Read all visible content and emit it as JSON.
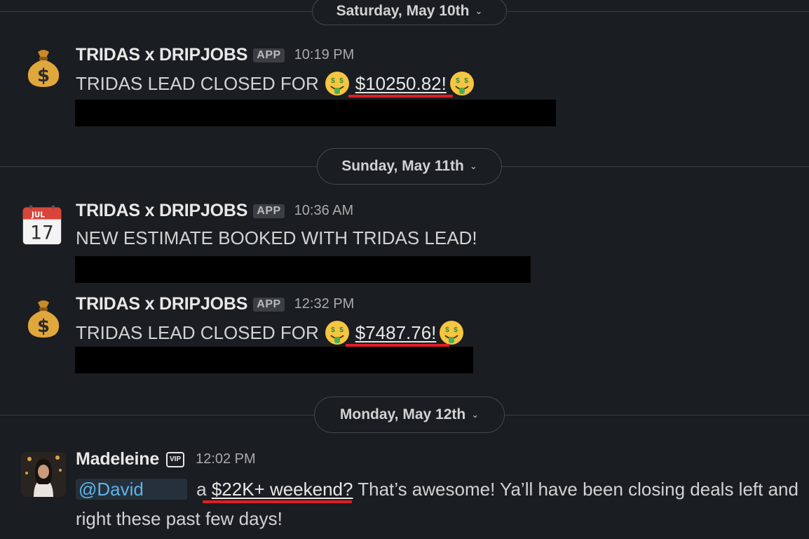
{
  "dates": [
    {
      "label": "Saturday, May 10th",
      "chevron": "chevron-down-icon"
    },
    {
      "label": "Sunday, May 11th",
      "chevron": "chevron-down-icon"
    },
    {
      "label": "Monday, May 12th",
      "chevron": "chevron-down-icon"
    }
  ],
  "messages": [
    {
      "avatar_icon": "money-bag-icon",
      "sender": "TRIDAS x DRIPJOBS",
      "badge": "APP",
      "time": "10:19 PM",
      "text_prefix": "TRIDAS LEAD CLOSED FOR",
      "amount": "$10250.82!",
      "emoji": "money-mouth-face-icon"
    },
    {
      "avatar_icon": "calendar-icon",
      "avatar_text_month": "JUL",
      "avatar_text_day": "17",
      "sender": "TRIDAS x DRIPJOBS",
      "badge": "APP",
      "time": "10:36 AM",
      "text": "NEW ESTIMATE BOOKED WITH TRIDAS LEAD!"
    },
    {
      "avatar_icon": "money-bag-icon",
      "sender": "TRIDAS x DRIPJOBS",
      "badge": "APP",
      "time": "12:32 PM",
      "text_prefix": "TRIDAS LEAD CLOSED FOR",
      "amount": "$7487.76!",
      "emoji": "money-mouth-face-icon"
    },
    {
      "avatar_icon": "user-photo-avatar",
      "sender": "Madeleine",
      "badge_icon": "vip-icon",
      "badge": "VIP",
      "time": "12:02 PM",
      "mention": "@David",
      "text_a": "a",
      "highlight": "$22K+ weekend?",
      "text_rest": " That’s awesome! Ya’ll have been closing deals left and right these past few days!"
    }
  ],
  "colors": {
    "background": "#1a1d21",
    "annotation_red": "#e01e24",
    "mention_blue": "#5eb4e8",
    "redaction": "#000000"
  }
}
